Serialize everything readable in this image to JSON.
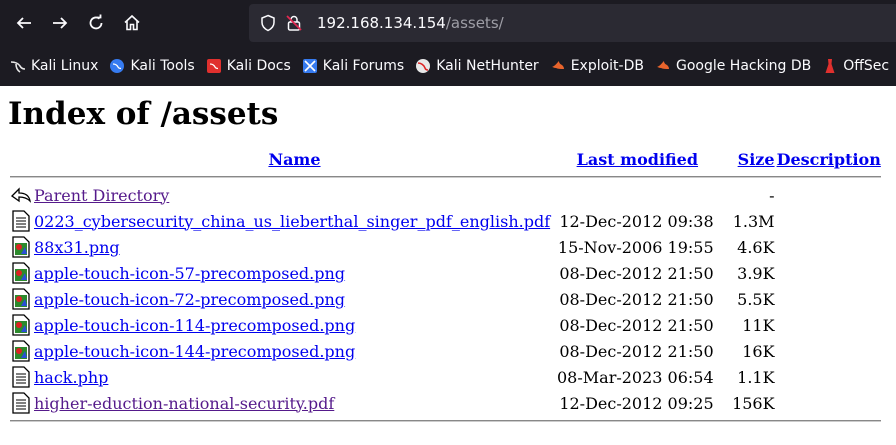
{
  "browser": {
    "url_host": "192.168.134.154",
    "url_path": "/assets/",
    "bookmarks": [
      {
        "label": "Kali Linux",
        "icon": "kali-dragon-icon"
      },
      {
        "label": "Kali Tools",
        "icon": "kali-tools-icon"
      },
      {
        "label": "Kali Docs",
        "icon": "kali-docs-icon"
      },
      {
        "label": "Kali Forums",
        "icon": "kali-forums-icon"
      },
      {
        "label": "Kali NetHunter",
        "icon": "kali-nethunter-icon"
      },
      {
        "label": "Exploit-DB",
        "icon": "exploit-db-icon"
      },
      {
        "label": "Google Hacking DB",
        "icon": "ghdb-icon"
      },
      {
        "label": "OffSec",
        "icon": "offsec-icon"
      }
    ]
  },
  "page": {
    "title": "Index of /assets",
    "columns": {
      "name": "Name",
      "modified": "Last modified",
      "size": "Size",
      "description": "Description"
    },
    "rows": [
      {
        "name": "Parent Directory",
        "modified": "",
        "size": "-",
        "icon": "back-icon"
      },
      {
        "name": "0223_cybersecurity_china_us_lieberthal_singer_pdf_english.pdf",
        "modified": "12-Dec-2012 09:38",
        "size": "1.3M",
        "icon": "text-file-icon"
      },
      {
        "name": "88x31.png",
        "modified": "15-Nov-2006 19:55",
        "size": "4.6K",
        "icon": "image-file-icon"
      },
      {
        "name": "apple-touch-icon-57-precomposed.png",
        "modified": "08-Dec-2012 21:50",
        "size": "3.9K",
        "icon": "image-file-icon"
      },
      {
        "name": "apple-touch-icon-72-precomposed.png",
        "modified": "08-Dec-2012 21:50",
        "size": "5.5K",
        "icon": "image-file-icon"
      },
      {
        "name": "apple-touch-icon-114-precomposed.png",
        "modified": "08-Dec-2012 21:50",
        "size": "11K",
        "icon": "image-file-icon"
      },
      {
        "name": "apple-touch-icon-144-precomposed.png",
        "modified": "08-Dec-2012 21:50",
        "size": "16K",
        "icon": "image-file-icon"
      },
      {
        "name": "hack.php",
        "modified": "08-Mar-2023 06:54",
        "size": "1.1K",
        "icon": "text-file-icon"
      },
      {
        "name": "higher-eduction-national-security.pdf",
        "modified": "12-Dec-2012 09:25",
        "size": "156K",
        "icon": "text-file-icon"
      }
    ]
  }
}
